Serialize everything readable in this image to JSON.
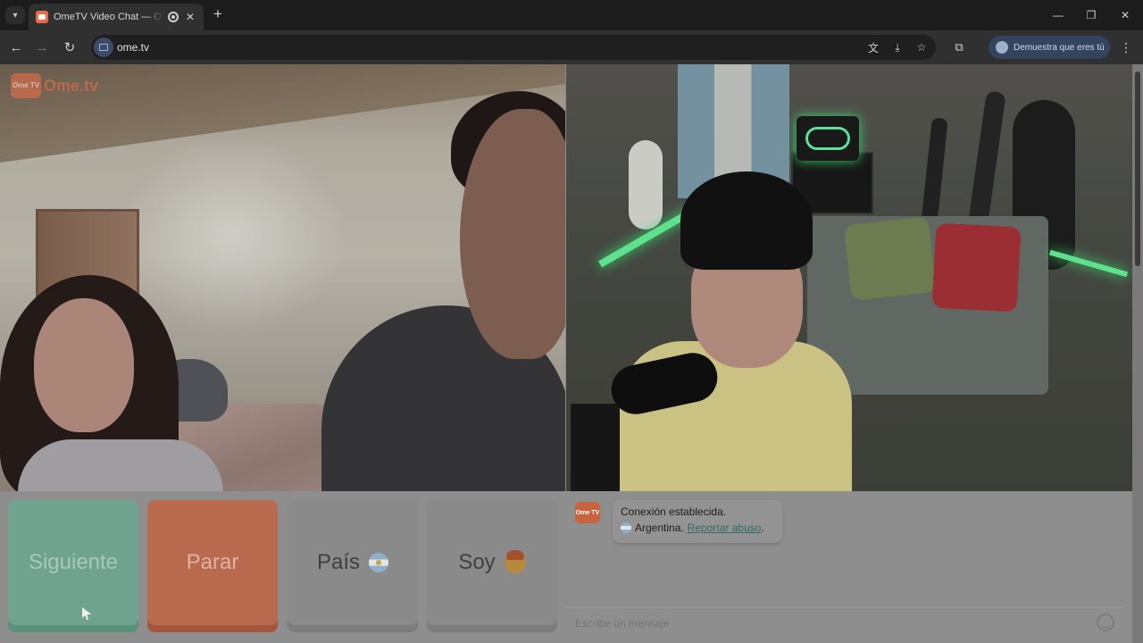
{
  "browser": {
    "tab_title": "OmeTV Video Chat — Ome",
    "new_tab_symbol": "+",
    "url": "ome.tv",
    "verify_label": "Demuestra que eres tú"
  },
  "left_video": {
    "logo_box": "Ome TV",
    "logo_text": "Ome.tv"
  },
  "controls": {
    "next_label": "Siguiente",
    "stop_label": "Parar",
    "country_label": "País",
    "gender_label": "Soy"
  },
  "chat": {
    "logo": "Ome TV",
    "connection_text": "Conexión establecida.",
    "country_text": "Argentina.",
    "report_link": "Reportar abuso",
    "report_suffix": ".",
    "input_placeholder": "Escribe un mensaje"
  },
  "icons": {
    "country_flag": "argentina-flag-icon",
    "gender_emoji": "boy-emoji-icon",
    "emoji_button": "smiley-icon"
  }
}
